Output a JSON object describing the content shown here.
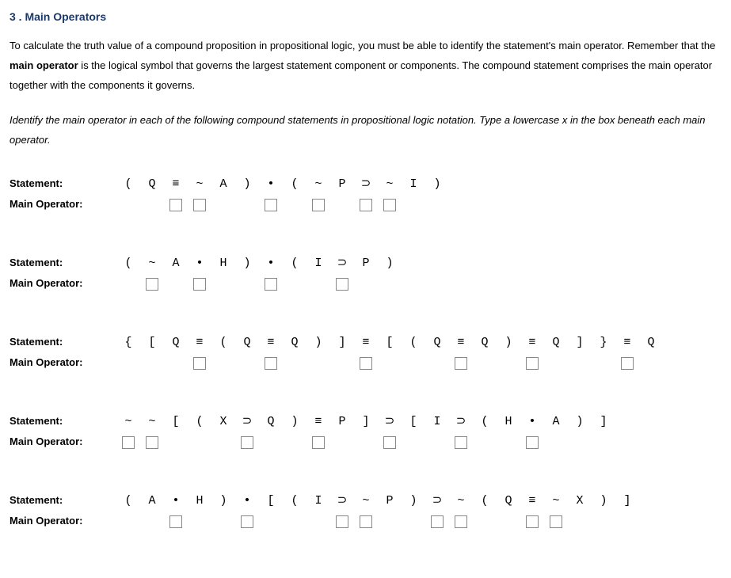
{
  "heading": "3 . Main Operators",
  "intro_pre": "To calculate the truth value of a compound proposition in propositional logic, you must be able to identify the statement's main operator. Remember that the ",
  "intro_bold": "main operator",
  "intro_post": " is the logical symbol that governs the largest statement component or components. The compound statement comprises the main operator together with the components it governs.",
  "instructions": "Identify the main operator in each of the following compound statements in propositional logic notation. Type a lowercase x in the box beneath each main operator.",
  "labels": {
    "statement": "Statement:",
    "main_op": "Main Operator:"
  },
  "problems": [
    {
      "symbols": [
        "(",
        "Q",
        "≡",
        "~",
        "A",
        ")",
        "•",
        "(",
        "~",
        "P",
        "⊃",
        "~",
        "I",
        ")"
      ],
      "boxes": [
        0,
        0,
        1,
        1,
        0,
        0,
        1,
        0,
        1,
        0,
        1,
        1,
        0,
        0
      ]
    },
    {
      "symbols": [
        "(",
        "~",
        "A",
        "•",
        "H",
        ")",
        "•",
        "(",
        "I",
        "⊃",
        "P",
        ")"
      ],
      "boxes": [
        0,
        1,
        0,
        1,
        0,
        0,
        1,
        0,
        0,
        1,
        0,
        0
      ]
    },
    {
      "symbols": [
        "{",
        "[",
        "Q",
        "≡",
        "(",
        "Q",
        "≡",
        "Q",
        ")",
        "]",
        "≡",
        "[",
        "(",
        "Q",
        "≡",
        "Q",
        ")",
        "≡",
        "Q",
        "]",
        "}",
        "≡",
        "Q"
      ],
      "boxes": [
        0,
        0,
        0,
        1,
        0,
        0,
        1,
        0,
        0,
        0,
        1,
        0,
        0,
        0,
        1,
        0,
        0,
        1,
        0,
        0,
        0,
        1,
        0
      ]
    },
    {
      "symbols": [
        "~",
        "~",
        "[",
        "(",
        "X",
        "⊃",
        "Q",
        ")",
        "≡",
        "P",
        "]",
        "⊃",
        "[",
        "I",
        "⊃",
        "(",
        "H",
        "•",
        "A",
        ")",
        "]"
      ],
      "boxes": [
        1,
        1,
        0,
        0,
        0,
        1,
        0,
        0,
        1,
        0,
        0,
        1,
        0,
        0,
        1,
        0,
        0,
        1,
        0,
        0,
        0
      ]
    },
    {
      "symbols": [
        "(",
        "A",
        "•",
        "H",
        ")",
        "•",
        "[",
        "(",
        "I",
        "⊃",
        "~",
        "P",
        ")",
        "⊃",
        "~",
        "(",
        "Q",
        "≡",
        "~",
        "X",
        ")",
        "]"
      ],
      "boxes": [
        0,
        0,
        1,
        0,
        0,
        1,
        0,
        0,
        0,
        1,
        1,
        0,
        0,
        1,
        1,
        0,
        0,
        1,
        1,
        0,
        0,
        0
      ]
    }
  ]
}
